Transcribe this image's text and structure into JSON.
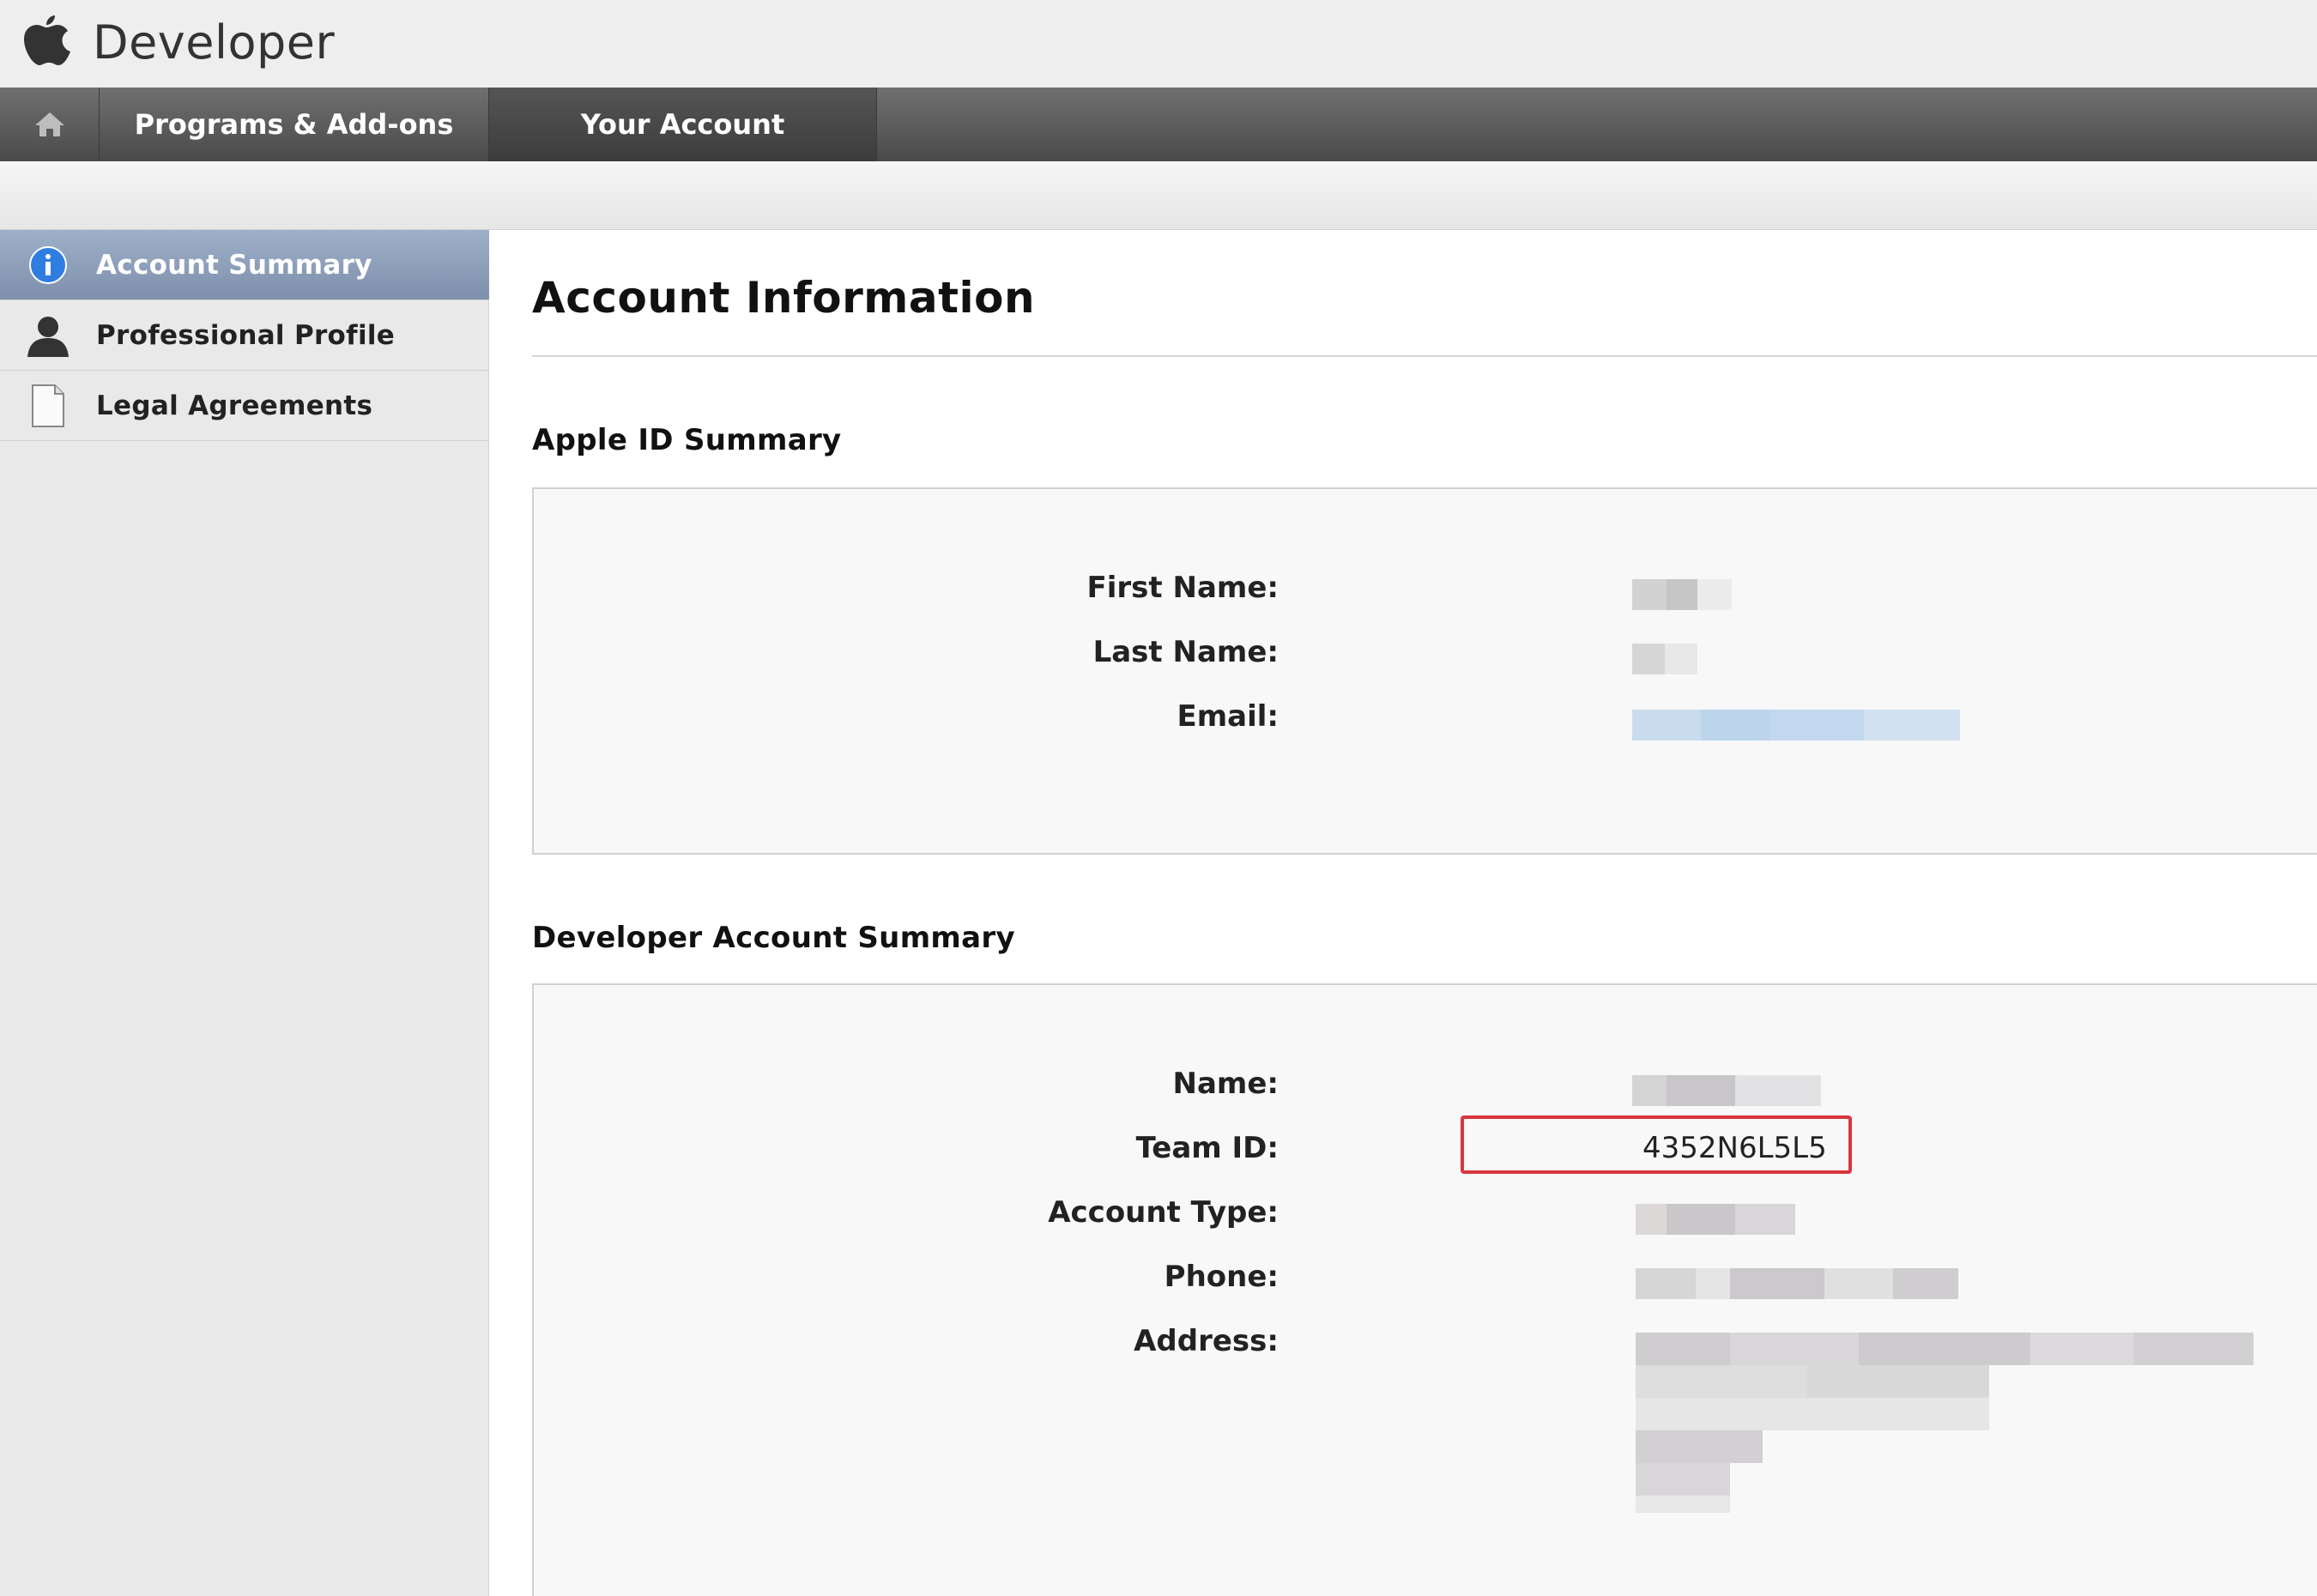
{
  "brand": {
    "name": "Developer"
  },
  "nav": {
    "home_icon": "home-icon",
    "tabs": [
      {
        "label": "Programs & Add-ons"
      },
      {
        "label": "Your Account"
      }
    ]
  },
  "sidebar": {
    "items": [
      {
        "label": "Account Summary",
        "icon": "info-icon",
        "active": true
      },
      {
        "label": "Professional Profile",
        "icon": "person-icon"
      },
      {
        "label": "Legal Agreements",
        "icon": "document-icon"
      }
    ]
  },
  "main": {
    "title": "Account Information",
    "apple_id": {
      "title": "Apple ID Summary",
      "fields": [
        {
          "label": "First Name:"
        },
        {
          "label": "Last Name:"
        },
        {
          "label": "Email:"
        }
      ]
    },
    "developer": {
      "title": "Developer Account Summary",
      "fields": [
        {
          "label": "Name:"
        },
        {
          "label": "Team ID:",
          "value": "4352N6L5L5"
        },
        {
          "label": "Account Type:"
        },
        {
          "label": "Phone:"
        },
        {
          "label": "Address:"
        }
      ]
    }
  },
  "colors": {
    "highlight": "#d9363e",
    "active_sidebar": "#8a9bb6",
    "navbar": "#5a5a5a"
  }
}
